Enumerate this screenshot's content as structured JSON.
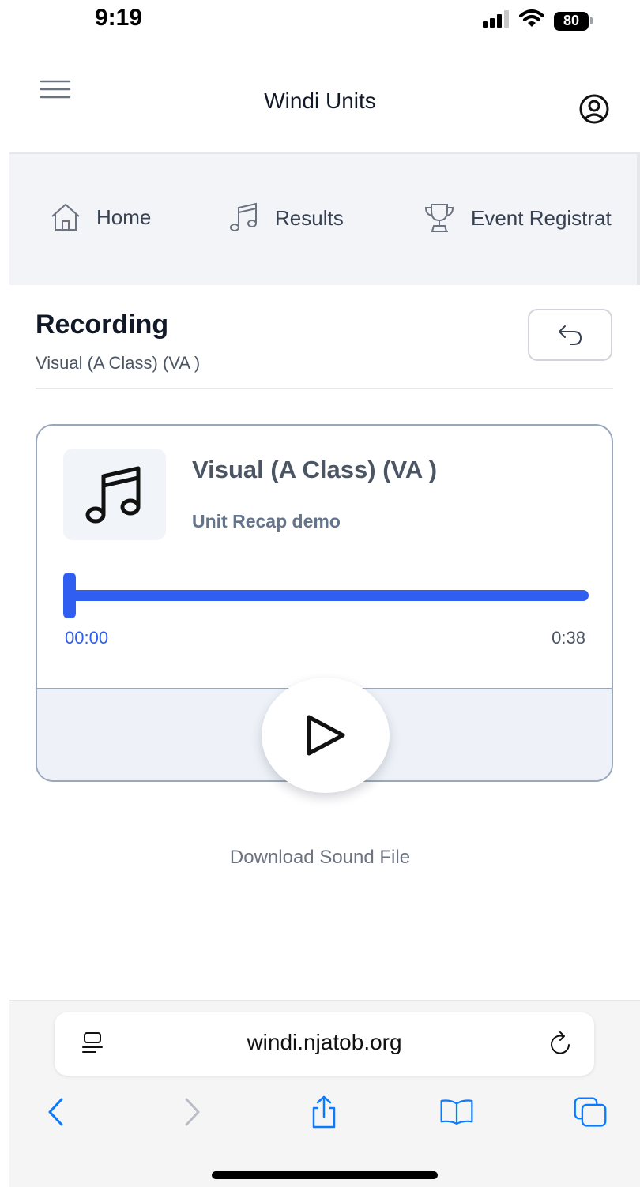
{
  "status_bar": {
    "time": "9:19",
    "battery": "80"
  },
  "header": {
    "title": "Windi Units"
  },
  "nav": {
    "items": [
      {
        "label": "Home",
        "icon": "home-icon"
      },
      {
        "label": "Results",
        "icon": "music-note-icon"
      },
      {
        "label": "Event Registrat",
        "icon": "trophy-icon"
      }
    ]
  },
  "recording": {
    "title": "Recording",
    "subtitle": "Visual (A Class) (VA )"
  },
  "player": {
    "track_title": "Visual (A Class) (VA )",
    "track_subtitle": "Unit Recap demo",
    "current_time": "00:00",
    "total_time": "0:38",
    "progress": 0
  },
  "download": {
    "label": "Download Sound File"
  },
  "browser": {
    "url": "windi.njatob.org"
  },
  "colors": {
    "accent": "#2f5ef0",
    "ios_blue": "#0a7aff",
    "card_border": "#9aa8bd"
  }
}
